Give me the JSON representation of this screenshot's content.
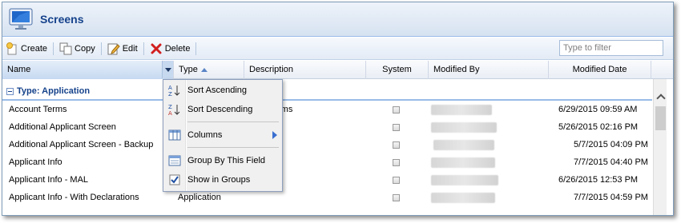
{
  "app": {
    "title": "Screens"
  },
  "toolbar": {
    "create": "Create",
    "copy": "Copy",
    "edit": "Edit",
    "delete": "Delete",
    "filter_placeholder": "Type to filter"
  },
  "columns": {
    "name": "Name",
    "type": "Type",
    "description": "Description",
    "system": "System",
    "modified_by": "Modified By",
    "modified_date": "Modified Date"
  },
  "group": {
    "label": "Type: Application"
  },
  "rows": [
    {
      "name": "Account Terms",
      "type": "",
      "description": "rms",
      "system": false,
      "modified_date": "6/29/2015 09:59 AM"
    },
    {
      "name": "Additional Applicant Screen",
      "type": "",
      "description": "",
      "system": false,
      "modified_date": "5/26/2015 02:16 PM"
    },
    {
      "name": "Additional Applicant Screen - Backup",
      "type": "",
      "description": "",
      "system": false,
      "modified_date": "5/7/2015 04:09 PM"
    },
    {
      "name": "Applicant Info",
      "type": "",
      "description": "",
      "system": false,
      "modified_date": "7/7/2015 04:40 PM"
    },
    {
      "name": "Applicant Info - MAL",
      "type": "",
      "description": "",
      "system": false,
      "modified_date": "6/26/2015 12:53 PM"
    },
    {
      "name": "Applicant Info - With Declarations",
      "type": "Application",
      "description": "",
      "system": false,
      "modified_date": "7/7/2015 04:59 PM"
    }
  ],
  "menu": {
    "sort_asc": "Sort Ascending",
    "sort_desc": "Sort Descending",
    "columns": "Columns",
    "group_by": "Group By This Field",
    "show_in_groups": "Show in Groups"
  },
  "colors": {
    "accent": "#15428b",
    "header_bg": "#d6e2f1"
  }
}
